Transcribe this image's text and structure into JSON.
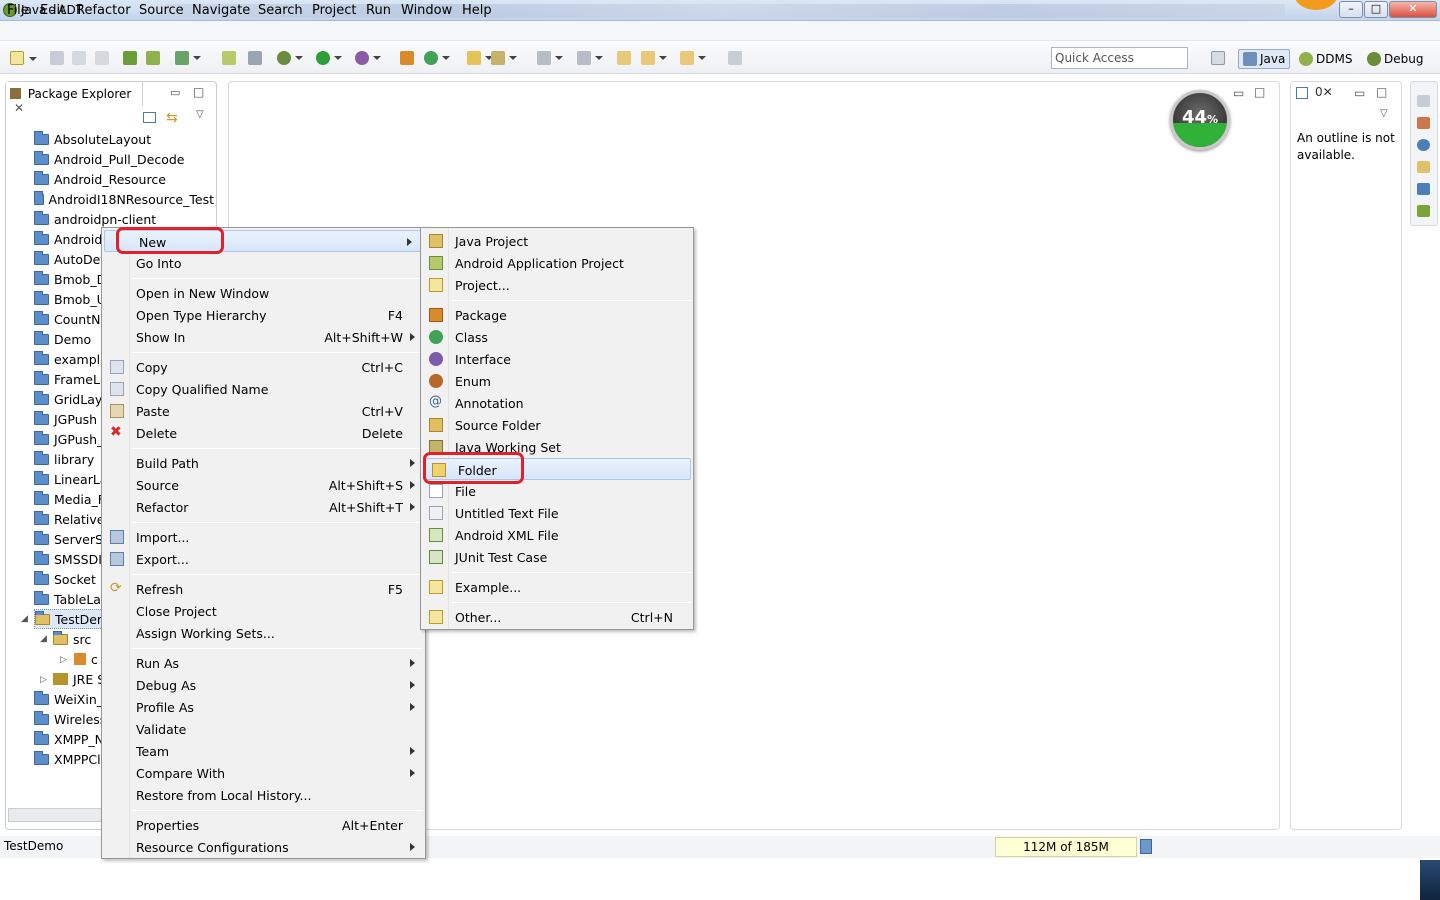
{
  "window": {
    "title": "Java - ADT"
  },
  "menubar": [
    "File",
    "Edit",
    "Refactor",
    "Source",
    "Navigate",
    "Search",
    "Project",
    "Run",
    "Window",
    "Help"
  ],
  "toolbar": {
    "quick_access": "Quick Access"
  },
  "perspectives": {
    "java": "Java",
    "ddms": "DDMS",
    "debug": "Debug"
  },
  "package_explorer": {
    "tab": "Package Explorer",
    "items": [
      "AbsoluteLayout",
      "Android_Pull_Decode",
      "Android_Resource",
      "AndroidI18NResource_Test",
      "androidpn-client",
      "Android",
      "AutoDet",
      "Bmob_D",
      "Bmob_U",
      "CountN",
      "Demo",
      "example",
      "FrameL",
      "GridLay",
      "JGPush",
      "JGPush_",
      "library",
      "LinearLa",
      "Media_F",
      "Relative",
      "ServerS",
      "SMSSDI",
      "Socket",
      "TableLa",
      "TestDer",
      "src",
      "c",
      "JRE S",
      "WeiXin_",
      "Wireless",
      "XMPP_N",
      "XMPPCl"
    ]
  },
  "outline": {
    "message": "An outline is not available."
  },
  "gauge": {
    "label": "44",
    "unit": "%",
    "percent": 44
  },
  "status": {
    "selection": "TestDemo",
    "heap": "112M of 185M"
  },
  "context_menu": {
    "items": [
      {
        "label": "New",
        "accel": "",
        "submenu": true
      },
      {
        "label": "Go Into",
        "accel": ""
      },
      {
        "label": "Open in New Window",
        "accel": ""
      },
      {
        "label": "Open Type Hierarchy",
        "accel": "F4"
      },
      {
        "label": "Show In",
        "accel": "Alt+Shift+W",
        "submenu": true
      },
      {
        "label": "Copy",
        "accel": "Ctrl+C"
      },
      {
        "label": "Copy Qualified Name",
        "accel": ""
      },
      {
        "label": "Paste",
        "accel": "Ctrl+V"
      },
      {
        "label": "Delete",
        "accel": "Delete"
      },
      {
        "label": "Build Path",
        "accel": "",
        "submenu": true
      },
      {
        "label": "Source",
        "accel": "Alt+Shift+S",
        "submenu": true
      },
      {
        "label": "Refactor",
        "accel": "Alt+Shift+T",
        "submenu": true
      },
      {
        "label": "Import...",
        "accel": ""
      },
      {
        "label": "Export...",
        "accel": ""
      },
      {
        "label": "Refresh",
        "accel": "F5"
      },
      {
        "label": "Close Project",
        "accel": ""
      },
      {
        "label": "Assign Working Sets...",
        "accel": ""
      },
      {
        "label": "Run As",
        "accel": "",
        "submenu": true
      },
      {
        "label": "Debug As",
        "accel": "",
        "submenu": true
      },
      {
        "label": "Profile As",
        "accel": "",
        "submenu": true
      },
      {
        "label": "Validate",
        "accel": ""
      },
      {
        "label": "Team",
        "accel": "",
        "submenu": true
      },
      {
        "label": "Compare With",
        "accel": "",
        "submenu": true
      },
      {
        "label": "Restore from Local History...",
        "accel": ""
      },
      {
        "label": "Properties",
        "accel": "Alt+Enter"
      },
      {
        "label": "Resource Configurations",
        "accel": "",
        "submenu": true
      }
    ]
  },
  "new_submenu": {
    "items": [
      {
        "label": "Java Project",
        "accel": ""
      },
      {
        "label": "Android Application Project",
        "accel": ""
      },
      {
        "label": "Project...",
        "accel": ""
      },
      {
        "label": "Package",
        "accel": ""
      },
      {
        "label": "Class",
        "accel": ""
      },
      {
        "label": "Interface",
        "accel": ""
      },
      {
        "label": "Enum",
        "accel": ""
      },
      {
        "label": "Annotation",
        "accel": ""
      },
      {
        "label": "Source Folder",
        "accel": ""
      },
      {
        "label": "Java Working Set",
        "accel": ""
      },
      {
        "label": "Folder",
        "accel": ""
      },
      {
        "label": "File",
        "accel": ""
      },
      {
        "label": "Untitled Text File",
        "accel": ""
      },
      {
        "label": "Android XML File",
        "accel": ""
      },
      {
        "label": "JUnit Test Case",
        "accel": ""
      },
      {
        "label": "Example...",
        "accel": ""
      },
      {
        "label": "Other...",
        "accel": "Ctrl+N"
      }
    ]
  },
  "colors": {
    "annotation_red": "#e0202a",
    "highlight": "#d8e6fa",
    "gauge_green": "#32b13a"
  }
}
